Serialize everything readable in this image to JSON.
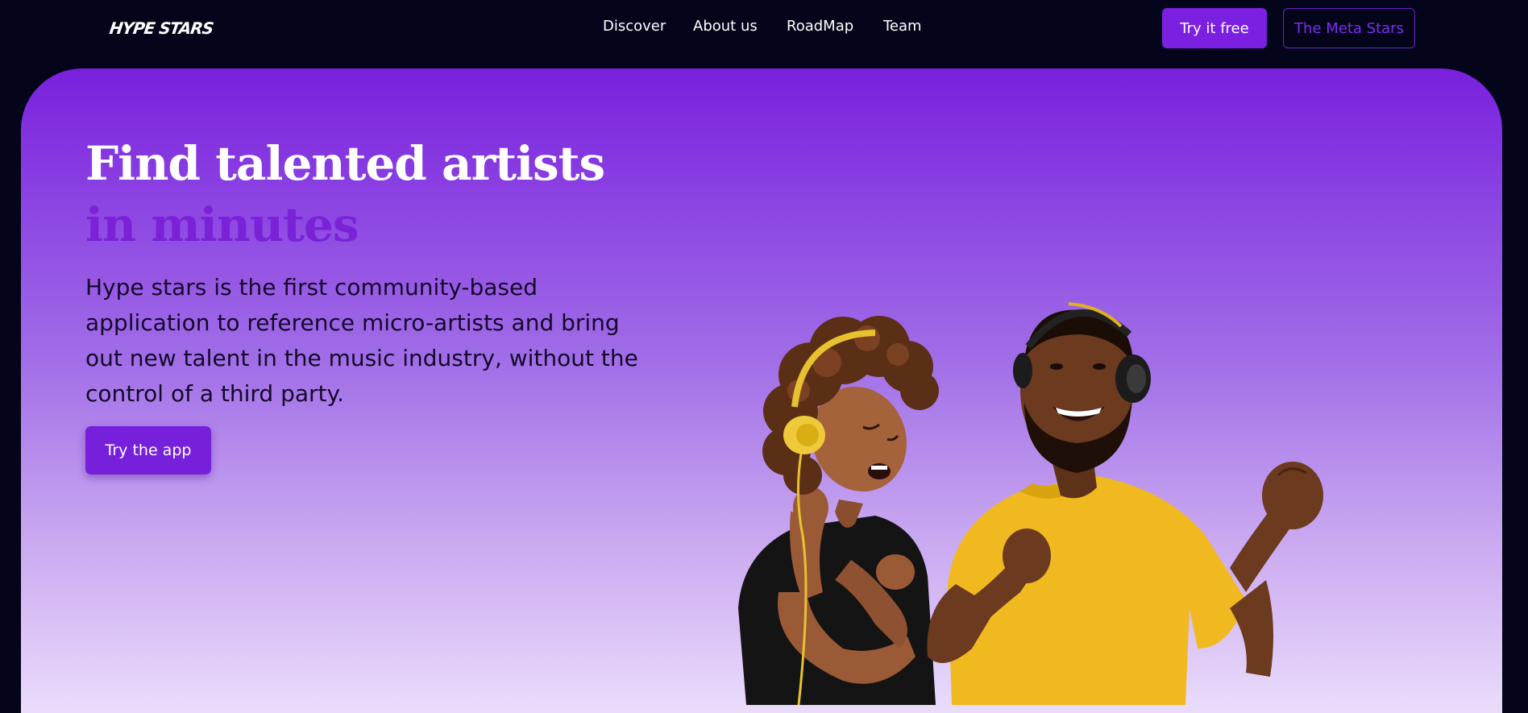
{
  "nav": {
    "logo": "HYPE STARS",
    "links": [
      "Discover",
      "About us",
      "RoadMap",
      "Team"
    ],
    "try_free_label": "Try it free",
    "meta_stars_label": "The Meta Stars"
  },
  "hero": {
    "title_line1": "Find talented artists",
    "title_line2": "in minutes",
    "description": "Hype stars is the first community-based application to reference micro-artists and bring out new talent in the music industry, without the control of a third party.",
    "cta_label": "Try the app",
    "image": "two-people-dancing-with-headphones"
  },
  "colors": {
    "background": "#04051a",
    "accent": "#7b1fe0",
    "hero_top": "#7920dd",
    "hero_bottom": "#eadcfa",
    "title_accent": "#7a22d8",
    "shirt_yellow": "#f0b91f"
  }
}
